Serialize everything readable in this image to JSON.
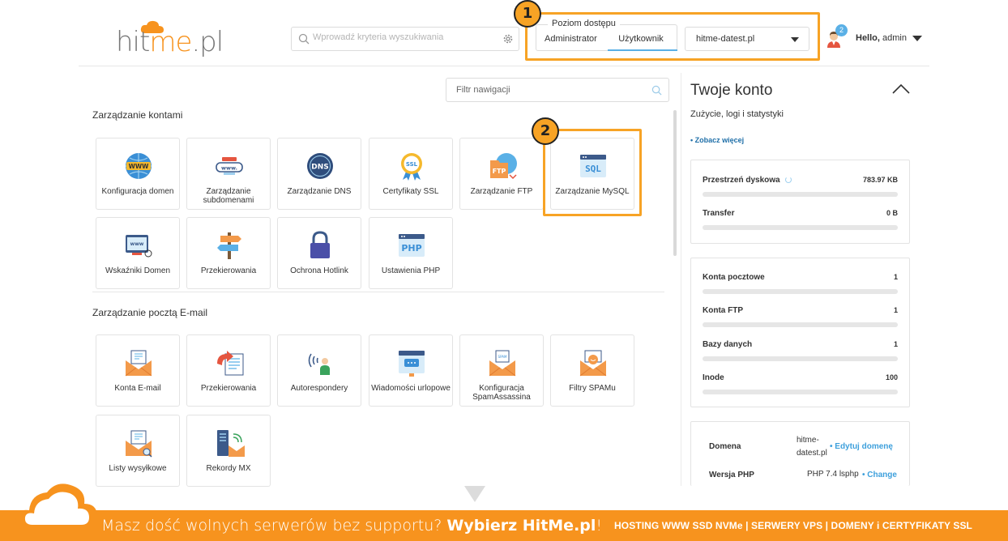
{
  "brand": {
    "logo_prefix": "hit",
    "logo_highlight": "me",
    "logo_suffix": ".pl",
    "accent": "#f7931e",
    "link_color": "#3ea0dc"
  },
  "search": {
    "placeholder": "Wprowadź kryteria wyszukiwania"
  },
  "access": {
    "legend": "Poziom dostępu",
    "options": [
      "Administrator",
      "Użytkownik"
    ],
    "selected": "Użytkownik"
  },
  "domain_select": {
    "value": "hitme-datest.pl"
  },
  "user": {
    "notifications": "2",
    "hello": "Hello,",
    "name": "admin"
  },
  "annotations": [
    "1",
    "2"
  ],
  "nav_filter": {
    "placeholder": "Filtr nawigacji"
  },
  "sections": [
    {
      "title": "Zarządzanie kontami",
      "tiles": [
        {
          "label": "Konfiguracja domen",
          "icon": "www-globe-icon"
        },
        {
          "label": "Zarządzanie subdomenami",
          "icon": "subdomain-icon"
        },
        {
          "label": "Zarządzanie DNS",
          "icon": "dns-icon"
        },
        {
          "label": "Certyfikaty SSL",
          "icon": "ssl-certificate-icon"
        },
        {
          "label": "Zarządzanie FTP",
          "icon": "ftp-icon"
        },
        {
          "label": "Zarządzanie MySQL",
          "icon": "sql-icon"
        },
        {
          "label": "Wskaźniki Domen",
          "icon": "domain-pointer-icon"
        },
        {
          "label": "Przekierowania",
          "icon": "signpost-icon"
        },
        {
          "label": "Ochrona Hotlink",
          "icon": "padlock-icon"
        },
        {
          "label": "Ustawienia PHP",
          "icon": "php-icon"
        }
      ]
    },
    {
      "title": "Zarządzanie pocztą E-mail",
      "tiles": [
        {
          "label": "Konta E-mail",
          "icon": "email-envelope-icon"
        },
        {
          "label": "Przekierowania",
          "icon": "email-forward-icon"
        },
        {
          "label": "Autorespondery",
          "icon": "autoresponder-icon"
        },
        {
          "label": "Wiadomości urlopowe",
          "icon": "vacation-message-icon"
        },
        {
          "label": "Konfiguracja SpamAssassina",
          "icon": "spamassassin-icon"
        },
        {
          "label": "Filtry SPAMu",
          "icon": "spam-filter-icon"
        },
        {
          "label": "Listy wysyłkowe",
          "icon": "mailing-list-icon"
        },
        {
          "label": "Rekordy MX",
          "icon": "mx-records-icon"
        }
      ]
    }
  ],
  "account": {
    "title": "Twoje konto",
    "subtitle": "Zużycie, logi i statystyki",
    "more": "• Zobacz więcej",
    "usage": [
      {
        "label": "Przestrzeń dyskowa",
        "value": "783.97 KB",
        "fill": 0
      },
      {
        "label": "Transfer",
        "value": "0 B",
        "fill": 0
      }
    ],
    "counts": [
      {
        "label": "Konta pocztowe",
        "value": "1",
        "fill": 0
      },
      {
        "label": "Konta FTP",
        "value": "1",
        "fill": 0
      },
      {
        "label": "Bazy danych",
        "value": "1",
        "fill": 0
      },
      {
        "label": "Inode",
        "value": "100",
        "fill": 0
      }
    ],
    "info": {
      "domain_label": "Domena",
      "domain_value_1": "hitme-",
      "domain_value_2": "datest.pl",
      "domain_link": "• Edytuj domenę",
      "php_label": "Wersja PHP",
      "php_value": "PHP 7.4 lsphp",
      "php_link": "• Change"
    }
  },
  "banner": {
    "text": "Masz dość wolnych serwerów bez supportu?",
    "bold": "Wybierz HitMe.pl",
    "tail": "!",
    "right": "HOSTING WWW SSD NVMe | SERWERY VPS | DOMENY i CERTYFIKATY SSL"
  }
}
